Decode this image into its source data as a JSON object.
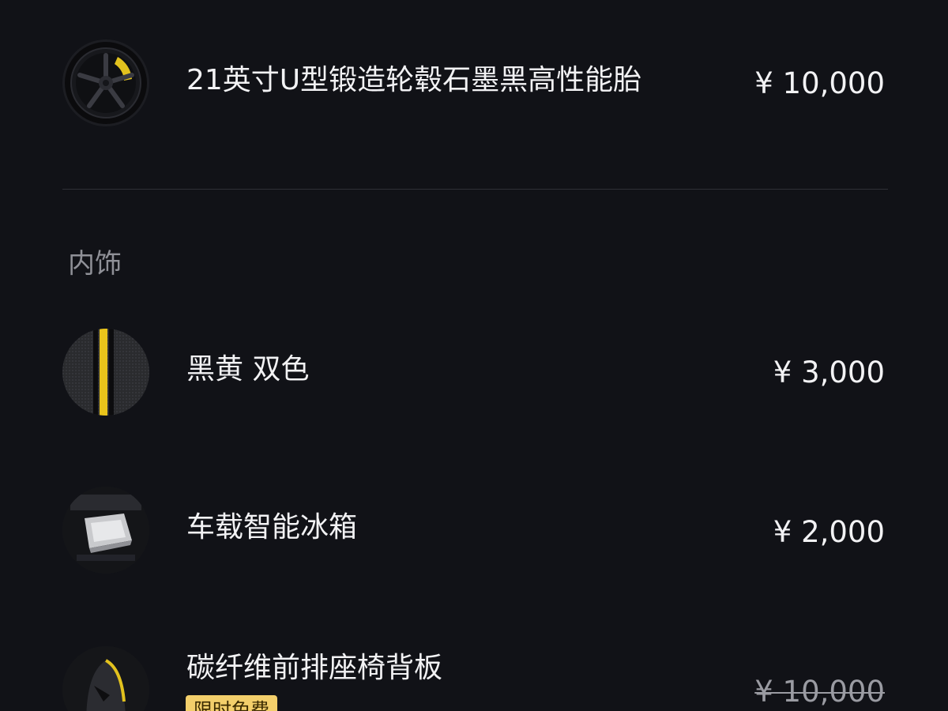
{
  "items_top": [
    {
      "name": "21英寸U型锻造轮毂石墨黑高性能胎",
      "price": "¥ 10,000",
      "icon": "wheel-icon"
    }
  ],
  "interior": {
    "section_title": "内饰",
    "items": [
      {
        "name": "黑黄 双色",
        "price": "¥ 3,000",
        "icon": "two-tone-interior-icon"
      },
      {
        "name": "车载智能冰箱",
        "price": "¥ 2,000",
        "icon": "fridge-icon"
      },
      {
        "name": "碳纤维前排座椅背板",
        "price": "¥ 10,000",
        "price_struck": true,
        "badge": "限时免费",
        "icon": "seat-back-icon"
      }
    ]
  },
  "colors": {
    "background": "#111217",
    "text": "#f2f2f4",
    "muted": "#8f9097",
    "accent_yellow": "#f3cf6b"
  }
}
